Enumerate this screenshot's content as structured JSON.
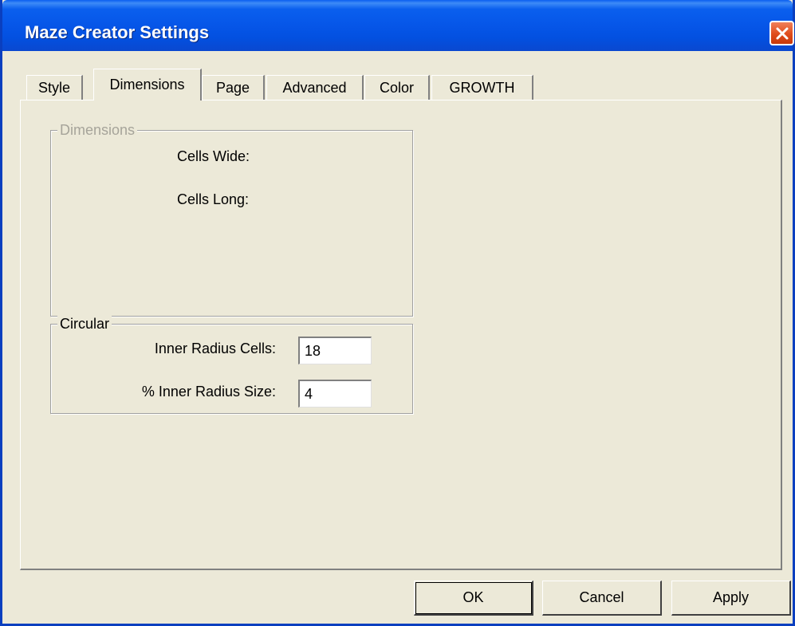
{
  "window": {
    "title": "Maze Creator Settings"
  },
  "tabs": [
    {
      "label": "Style",
      "active": false
    },
    {
      "label": "Dimensions",
      "active": true
    },
    {
      "label": "Page",
      "active": false
    },
    {
      "label": "Advanced",
      "active": false
    },
    {
      "label": "Color",
      "active": false
    },
    {
      "label": "GROWTH",
      "active": false
    }
  ],
  "dimensions_group": {
    "legend": "Dimensions",
    "cells_wide_label": "Cells Wide:",
    "cells_long_label": "Cells Long:",
    "enabled": false
  },
  "circular_group": {
    "legend": "Circular",
    "inner_radius_cells_label": "Inner Radius Cells:",
    "inner_radius_cells_value": "18",
    "inner_radius_size_label": "% Inner Radius Size:",
    "inner_radius_size_value": "4"
  },
  "buttons": {
    "ok": "OK",
    "cancel": "Cancel",
    "apply": "Apply"
  },
  "colors": {
    "titlebar": "#0a5fee",
    "close_button": "#e04c1c",
    "dialog_face": "#ece9d8",
    "disabled_text": "#a6a49a"
  },
  "icons": {
    "close": "close-icon"
  }
}
